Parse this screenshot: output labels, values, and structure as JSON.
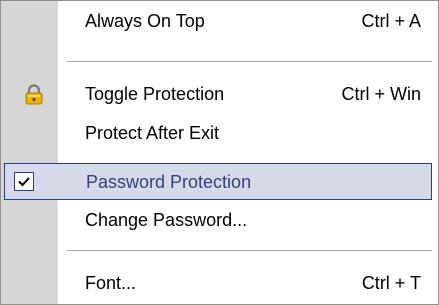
{
  "menu": {
    "items": [
      {
        "label": "Always On Top",
        "shortcut": "Ctrl + A"
      },
      {
        "label": "Toggle Protection",
        "shortcut": "Ctrl + Win",
        "icon": "lock-icon"
      },
      {
        "label": "Protect After Exit",
        "shortcut": ""
      },
      {
        "label": "Password Protection",
        "shortcut": "",
        "checked": true,
        "highlighted": true
      },
      {
        "label": "Change Password...",
        "shortcut": ""
      },
      {
        "label": "Font...",
        "shortcut": "Ctrl + T"
      }
    ]
  },
  "colors": {
    "gutter": "#d6d6d6",
    "highlight_fill": "#d5d9ea",
    "highlight_border": "#2e3a85",
    "highlight_text": "#36417e",
    "separator": "#a6a6a6",
    "lock_body": "#e8b400"
  }
}
